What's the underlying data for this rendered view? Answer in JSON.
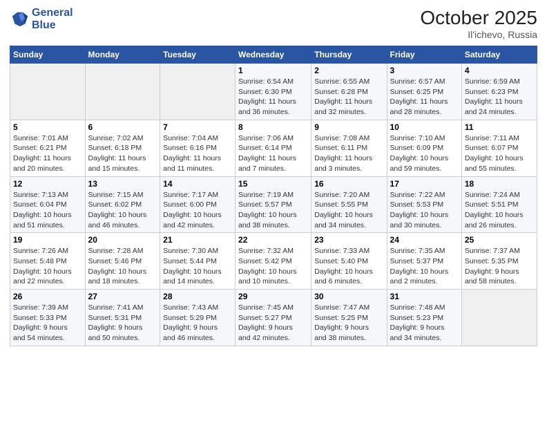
{
  "header": {
    "logo_line1": "General",
    "logo_line2": "Blue",
    "month_title": "October 2025",
    "location": "Il'ichevo, Russia"
  },
  "weekdays": [
    "Sunday",
    "Monday",
    "Tuesday",
    "Wednesday",
    "Thursday",
    "Friday",
    "Saturday"
  ],
  "weeks": [
    [
      {
        "day": "",
        "info": ""
      },
      {
        "day": "",
        "info": ""
      },
      {
        "day": "",
        "info": ""
      },
      {
        "day": "1",
        "info": "Sunrise: 6:54 AM\nSunset: 6:30 PM\nDaylight: 11 hours\nand 36 minutes."
      },
      {
        "day": "2",
        "info": "Sunrise: 6:55 AM\nSunset: 6:28 PM\nDaylight: 11 hours\nand 32 minutes."
      },
      {
        "day": "3",
        "info": "Sunrise: 6:57 AM\nSunset: 6:25 PM\nDaylight: 11 hours\nand 28 minutes."
      },
      {
        "day": "4",
        "info": "Sunrise: 6:59 AM\nSunset: 6:23 PM\nDaylight: 11 hours\nand 24 minutes."
      }
    ],
    [
      {
        "day": "5",
        "info": "Sunrise: 7:01 AM\nSunset: 6:21 PM\nDaylight: 11 hours\nand 20 minutes."
      },
      {
        "day": "6",
        "info": "Sunrise: 7:02 AM\nSunset: 6:18 PM\nDaylight: 11 hours\nand 15 minutes."
      },
      {
        "day": "7",
        "info": "Sunrise: 7:04 AM\nSunset: 6:16 PM\nDaylight: 11 hours\nand 11 minutes."
      },
      {
        "day": "8",
        "info": "Sunrise: 7:06 AM\nSunset: 6:14 PM\nDaylight: 11 hours\nand 7 minutes."
      },
      {
        "day": "9",
        "info": "Sunrise: 7:08 AM\nSunset: 6:11 PM\nDaylight: 11 hours\nand 3 minutes."
      },
      {
        "day": "10",
        "info": "Sunrise: 7:10 AM\nSunset: 6:09 PM\nDaylight: 10 hours\nand 59 minutes."
      },
      {
        "day": "11",
        "info": "Sunrise: 7:11 AM\nSunset: 6:07 PM\nDaylight: 10 hours\nand 55 minutes."
      }
    ],
    [
      {
        "day": "12",
        "info": "Sunrise: 7:13 AM\nSunset: 6:04 PM\nDaylight: 10 hours\nand 51 minutes."
      },
      {
        "day": "13",
        "info": "Sunrise: 7:15 AM\nSunset: 6:02 PM\nDaylight: 10 hours\nand 46 minutes."
      },
      {
        "day": "14",
        "info": "Sunrise: 7:17 AM\nSunset: 6:00 PM\nDaylight: 10 hours\nand 42 minutes."
      },
      {
        "day": "15",
        "info": "Sunrise: 7:19 AM\nSunset: 5:57 PM\nDaylight: 10 hours\nand 38 minutes."
      },
      {
        "day": "16",
        "info": "Sunrise: 7:20 AM\nSunset: 5:55 PM\nDaylight: 10 hours\nand 34 minutes."
      },
      {
        "day": "17",
        "info": "Sunrise: 7:22 AM\nSunset: 5:53 PM\nDaylight: 10 hours\nand 30 minutes."
      },
      {
        "day": "18",
        "info": "Sunrise: 7:24 AM\nSunset: 5:51 PM\nDaylight: 10 hours\nand 26 minutes."
      }
    ],
    [
      {
        "day": "19",
        "info": "Sunrise: 7:26 AM\nSunset: 5:48 PM\nDaylight: 10 hours\nand 22 minutes."
      },
      {
        "day": "20",
        "info": "Sunrise: 7:28 AM\nSunset: 5:46 PM\nDaylight: 10 hours\nand 18 minutes."
      },
      {
        "day": "21",
        "info": "Sunrise: 7:30 AM\nSunset: 5:44 PM\nDaylight: 10 hours\nand 14 minutes."
      },
      {
        "day": "22",
        "info": "Sunrise: 7:32 AM\nSunset: 5:42 PM\nDaylight: 10 hours\nand 10 minutes."
      },
      {
        "day": "23",
        "info": "Sunrise: 7:33 AM\nSunset: 5:40 PM\nDaylight: 10 hours\nand 6 minutes."
      },
      {
        "day": "24",
        "info": "Sunrise: 7:35 AM\nSunset: 5:37 PM\nDaylight: 10 hours\nand 2 minutes."
      },
      {
        "day": "25",
        "info": "Sunrise: 7:37 AM\nSunset: 5:35 PM\nDaylight: 9 hours\nand 58 minutes."
      }
    ],
    [
      {
        "day": "26",
        "info": "Sunrise: 7:39 AM\nSunset: 5:33 PM\nDaylight: 9 hours\nand 54 minutes."
      },
      {
        "day": "27",
        "info": "Sunrise: 7:41 AM\nSunset: 5:31 PM\nDaylight: 9 hours\nand 50 minutes."
      },
      {
        "day": "28",
        "info": "Sunrise: 7:43 AM\nSunset: 5:29 PM\nDaylight: 9 hours\nand 46 minutes."
      },
      {
        "day": "29",
        "info": "Sunrise: 7:45 AM\nSunset: 5:27 PM\nDaylight: 9 hours\nand 42 minutes."
      },
      {
        "day": "30",
        "info": "Sunrise: 7:47 AM\nSunset: 5:25 PM\nDaylight: 9 hours\nand 38 minutes."
      },
      {
        "day": "31",
        "info": "Sunrise: 7:48 AM\nSunset: 5:23 PM\nDaylight: 9 hours\nand 34 minutes."
      },
      {
        "day": "",
        "info": ""
      }
    ]
  ]
}
